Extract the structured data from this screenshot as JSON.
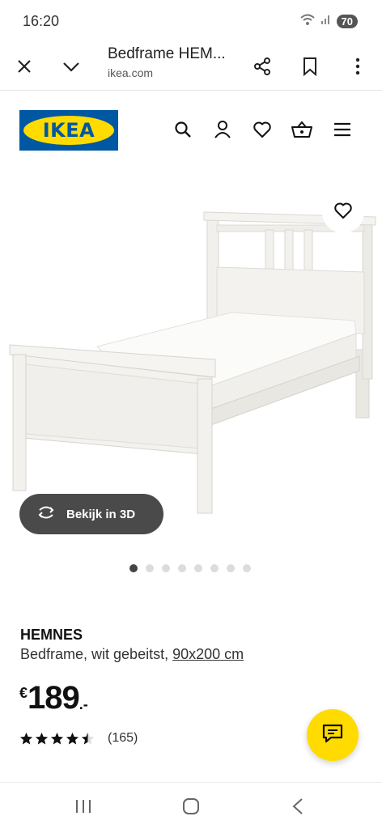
{
  "status_bar": {
    "time": "16:20",
    "battery": "70"
  },
  "browser": {
    "title": "Bedframe HEM...",
    "url": "ikea.com"
  },
  "site": {
    "logo_text": "IKEA"
  },
  "product": {
    "view_3d_label": "Bekijk in 3D",
    "image_count": 8,
    "active_image": 1,
    "name": "HEMNES",
    "description": "Bedframe, wit gebeitst, ",
    "size": "90x200 cm",
    "price_currency": "€",
    "price_int": "189",
    "price_dec": ".-",
    "rating": 4.5,
    "rating_max": 5,
    "review_count": "(165)"
  },
  "icons": {
    "browser": [
      "close-icon",
      "chevron-down-icon",
      "share-icon",
      "bookmark-icon",
      "more-vert-icon"
    ],
    "header": [
      "search-icon",
      "user-icon",
      "heart-icon",
      "basket-icon",
      "menu-icon"
    ],
    "nav": [
      "recent-apps-icon",
      "home-icon",
      "back-icon"
    ]
  },
  "colors": {
    "brand_blue": "#0058a3",
    "brand_yellow": "#ffdb00",
    "button_dark": "#4a4a4a"
  }
}
